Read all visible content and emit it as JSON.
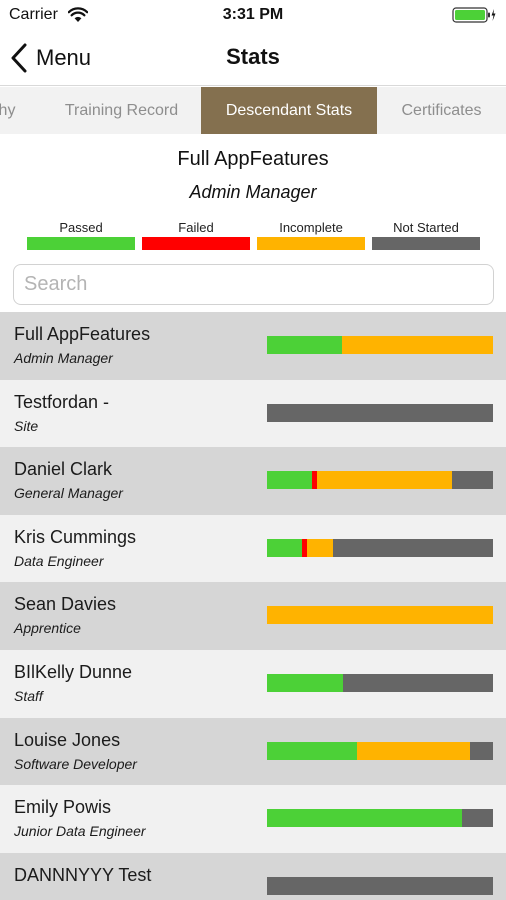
{
  "status_bar": {
    "carrier": "Carrier",
    "time": "3:31 PM",
    "icons": [
      "wifi-icon",
      "battery-icon"
    ]
  },
  "nav": {
    "back_label": "Menu",
    "back_icon": "chevron-left-icon",
    "title": "Stats"
  },
  "tabs": [
    {
      "label": "hy",
      "active": false
    },
    {
      "label": "Training Record",
      "active": false
    },
    {
      "label": "Descendant Stats",
      "active": true
    },
    {
      "label": "Certificates",
      "active": false
    }
  ],
  "header": {
    "name": "Full AppFeatures",
    "role": "Admin Manager"
  },
  "legend": [
    {
      "label": "Passed",
      "color": "#4cd137"
    },
    {
      "label": "Failed",
      "color": "#ff0000"
    },
    {
      "label": "Incomplete",
      "color": "#ffb300"
    },
    {
      "label": "Not Started",
      "color": "#666666"
    }
  ],
  "search": {
    "placeholder": "Search",
    "value": ""
  },
  "people": [
    {
      "name": "Full AppFeatures",
      "role": "Admin Manager",
      "progress": {
        "passed": 0.33,
        "failed": 0,
        "incomplete": 0.67,
        "not_started": 0
      }
    },
    {
      "name": "Testfordan -",
      "role": "Site",
      "progress": {
        "passed": 0,
        "failed": 0,
        "incomplete": 0,
        "not_started": 1
      }
    },
    {
      "name": "Daniel Clark",
      "role": "General Manager",
      "progress": {
        "passed": 0.2,
        "failed": 0.02,
        "incomplete": 0.6,
        "not_started": 0.18
      }
    },
    {
      "name": "Kris Cummings",
      "role": "Data Engineer",
      "progress": {
        "passed": 0.155,
        "failed": 0.02,
        "incomplete": 0.115,
        "not_started": 0.71
      }
    },
    {
      "name": "Sean Davies",
      "role": "Apprentice",
      "progress": {
        "passed": 0,
        "failed": 0,
        "incomplete": 1,
        "not_started": 0
      }
    },
    {
      "name": "BIlKelly Dunne",
      "role": "Staff",
      "progress": {
        "passed": 0.335,
        "failed": 0,
        "incomplete": 0,
        "not_started": 0.665
      }
    },
    {
      "name": "Louise Jones",
      "role": "Software Developer",
      "progress": {
        "passed": 0.4,
        "failed": 0,
        "incomplete": 0.5,
        "not_started": 0.1
      }
    },
    {
      "name": "Emily Powis",
      "role": "Junior Data Engineer",
      "progress": {
        "passed": 0.865,
        "failed": 0,
        "incomplete": 0,
        "not_started": 0.135
      }
    },
    {
      "name": "DANNNYYY Test",
      "role": "",
      "progress": {
        "passed": 0,
        "failed": 0,
        "incomplete": 0,
        "not_started": 1
      }
    }
  ]
}
